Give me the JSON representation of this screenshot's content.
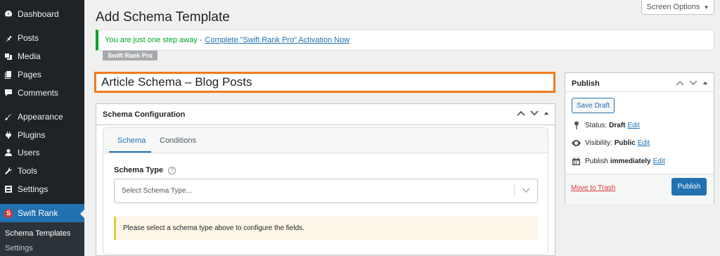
{
  "sidebar": {
    "items": [
      {
        "label": "Dashboard",
        "icon": "dashboard-icon"
      },
      {
        "label": "Posts",
        "icon": "pushpin-icon"
      },
      {
        "label": "Media",
        "icon": "media-icon"
      },
      {
        "label": "Pages",
        "icon": "pages-icon"
      },
      {
        "label": "Comments",
        "icon": "comment-icon"
      },
      {
        "label": "Appearance",
        "icon": "brush-icon"
      },
      {
        "label": "Plugins",
        "icon": "plugin-icon"
      },
      {
        "label": "Users",
        "icon": "user-icon"
      },
      {
        "label": "Tools",
        "icon": "wrench-icon"
      },
      {
        "label": "Settings",
        "icon": "settings-icon"
      },
      {
        "label": "Swift Rank",
        "icon": "swift-rank-logo-icon"
      }
    ],
    "submenu": [
      "Schema Templates",
      "Settings"
    ]
  },
  "header": {
    "title": "Add Schema Template",
    "screen_options": "Screen Options"
  },
  "notice": {
    "text": "You are just one step away -",
    "link": "Complete \"Swift Rank Pro\" Activation Now"
  },
  "pro_badge": "Swift Rank Pro",
  "post_title": "Article Schema – Blog Posts",
  "schema_config": {
    "title": "Schema Configuration",
    "tabs": [
      "Schema",
      "Conditions"
    ],
    "active_tab": "Schema",
    "field_label": "Schema Type",
    "help_icon": "?",
    "select_placeholder": "Select Schema Type...",
    "note": "Please select a schema type above to configure the fields."
  },
  "publish": {
    "title": "Publish",
    "save_draft": "Save Draft",
    "status_label": "Status:",
    "status_value": "Draft",
    "visibility_label": "Visibility:",
    "visibility_value": "Public",
    "publish_label": "Publish",
    "publish_value": "immediately",
    "edit": "Edit",
    "trash": "Move to Trash",
    "publish_button": "Publish"
  },
  "colors": {
    "sidebar_bg": "#1d2327",
    "accent": "#2271b1",
    "title_border": "#f07b1d",
    "notice_green": "#00a32a",
    "trash_red": "#d63638"
  }
}
